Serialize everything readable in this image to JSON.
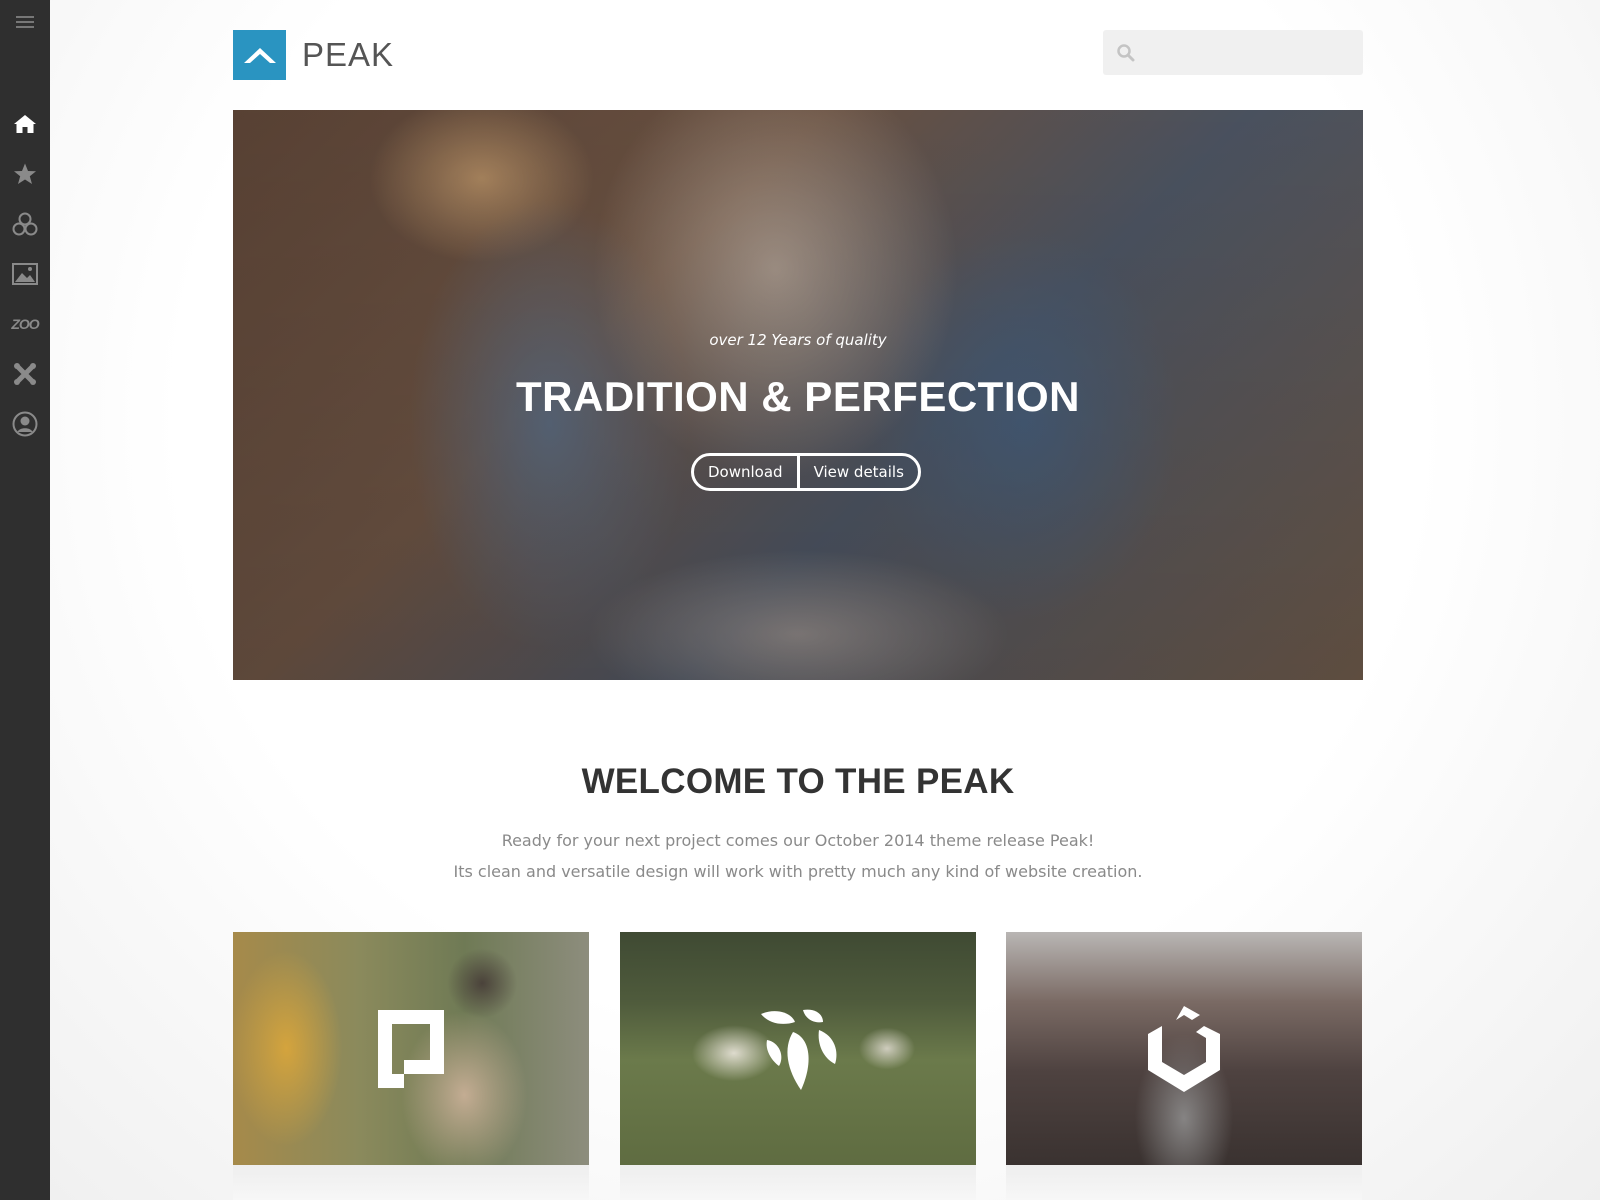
{
  "sidebar": {
    "items": [
      {
        "icon": "menu-icon",
        "active": false
      },
      {
        "icon": "home-icon",
        "active": true
      },
      {
        "icon": "star-icon",
        "active": false
      },
      {
        "icon": "circles-icon",
        "active": false
      },
      {
        "icon": "image-icon",
        "active": false
      },
      {
        "icon": "zoo-icon",
        "label": "ZOO",
        "active": false
      },
      {
        "icon": "joomla-icon",
        "active": false
      },
      {
        "icon": "user-icon",
        "active": false
      }
    ]
  },
  "header": {
    "logo_text": "PEAK",
    "logo_color": "#2a94c1",
    "search": {
      "placeholder": "",
      "value": ""
    }
  },
  "hero": {
    "subtitle": "over 12 Years of quality",
    "title": "TRADITION & PERFECTION",
    "buttons": [
      {
        "label": "Download"
      },
      {
        "label": "View details"
      }
    ]
  },
  "welcome": {
    "title": "WELCOME TO THE PEAK",
    "line1": "Ready for your next project comes our October 2014 theme release Peak!",
    "line2": "Its clean and versatile design will work with pretty much any kind of website creation."
  },
  "cards": [
    {
      "icon": "pagekit-logo-icon"
    },
    {
      "icon": "leaf-logo-icon"
    },
    {
      "icon": "uikit-logo-icon"
    }
  ]
}
